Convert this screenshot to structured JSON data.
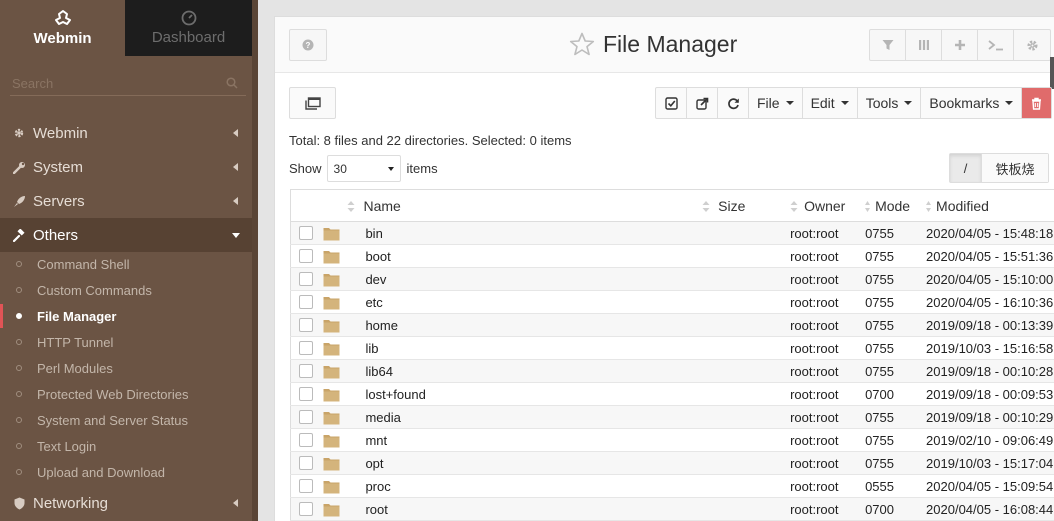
{
  "sidebar": {
    "tabs": [
      {
        "label": "Webmin",
        "icon": "webmin-logo-icon"
      },
      {
        "label": "Dashboard",
        "icon": "gauge-icon"
      }
    ],
    "search_placeholder": "Search",
    "categories": [
      {
        "label": "Webmin",
        "icon": "gear-icon"
      },
      {
        "label": "System",
        "icon": "wrench-icon"
      },
      {
        "label": "Servers",
        "icon": "rocket-icon"
      },
      {
        "label": "Others",
        "icon": "gavel-icon"
      },
      {
        "label": "Networking",
        "icon": "shield-icon"
      }
    ],
    "others_items": [
      "Command Shell",
      "Custom Commands",
      "File Manager",
      "HTTP Tunnel",
      "Perl Modules",
      "Protected Web Directories",
      "System and Server Status",
      "Text Login",
      "Upload and Download"
    ],
    "active_item": "File Manager"
  },
  "header": {
    "title": "File Manager"
  },
  "toolbar": {
    "file": "File",
    "edit": "Edit",
    "tools": "Tools",
    "bookmarks": "Bookmarks"
  },
  "summary": "Total: 8 files and 22 directories. Selected: 0 items",
  "show": {
    "label": "Show",
    "value": "30",
    "suffix": "items"
  },
  "path": {
    "root": "/",
    "dir": "铁板烧"
  },
  "columns": {
    "name": "Name",
    "size": "Size",
    "owner": "Owner",
    "mode": "Mode",
    "modified": "Modified"
  },
  "rows": [
    {
      "name": "bin",
      "owner": "root:root",
      "mode": "0755",
      "modified": "2020/04/05 - 15:48:18"
    },
    {
      "name": "boot",
      "owner": "root:root",
      "mode": "0755",
      "modified": "2020/04/05 - 15:51:36"
    },
    {
      "name": "dev",
      "owner": "root:root",
      "mode": "0755",
      "modified": "2020/04/05 - 15:10:00"
    },
    {
      "name": "etc",
      "owner": "root:root",
      "mode": "0755",
      "modified": "2020/04/05 - 16:10:36"
    },
    {
      "name": "home",
      "owner": "root:root",
      "mode": "0755",
      "modified": "2019/09/18 - 00:13:39"
    },
    {
      "name": "lib",
      "owner": "root:root",
      "mode": "0755",
      "modified": "2019/10/03 - 15:16:58"
    },
    {
      "name": "lib64",
      "owner": "root:root",
      "mode": "0755",
      "modified": "2019/09/18 - 00:10:28"
    },
    {
      "name": "lost+found",
      "owner": "root:root",
      "mode": "0700",
      "modified": "2019/09/18 - 00:09:53"
    },
    {
      "name": "media",
      "owner": "root:root",
      "mode": "0755",
      "modified": "2019/09/18 - 00:10:29"
    },
    {
      "name": "mnt",
      "owner": "root:root",
      "mode": "0755",
      "modified": "2019/02/10 - 09:06:49"
    },
    {
      "name": "opt",
      "owner": "root:root",
      "mode": "0755",
      "modified": "2019/10/03 - 15:17:04"
    },
    {
      "name": "proc",
      "owner": "root:root",
      "mode": "0555",
      "modified": "2020/04/05 - 15:09:54"
    },
    {
      "name": "root",
      "owner": "root:root",
      "mode": "0700",
      "modified": "2020/04/05 - 16:08:44"
    }
  ],
  "colors": {
    "sidebar": "#6b5444",
    "accent": "#e05456",
    "delete": "#e06b6b",
    "folder": "#c9a468"
  }
}
